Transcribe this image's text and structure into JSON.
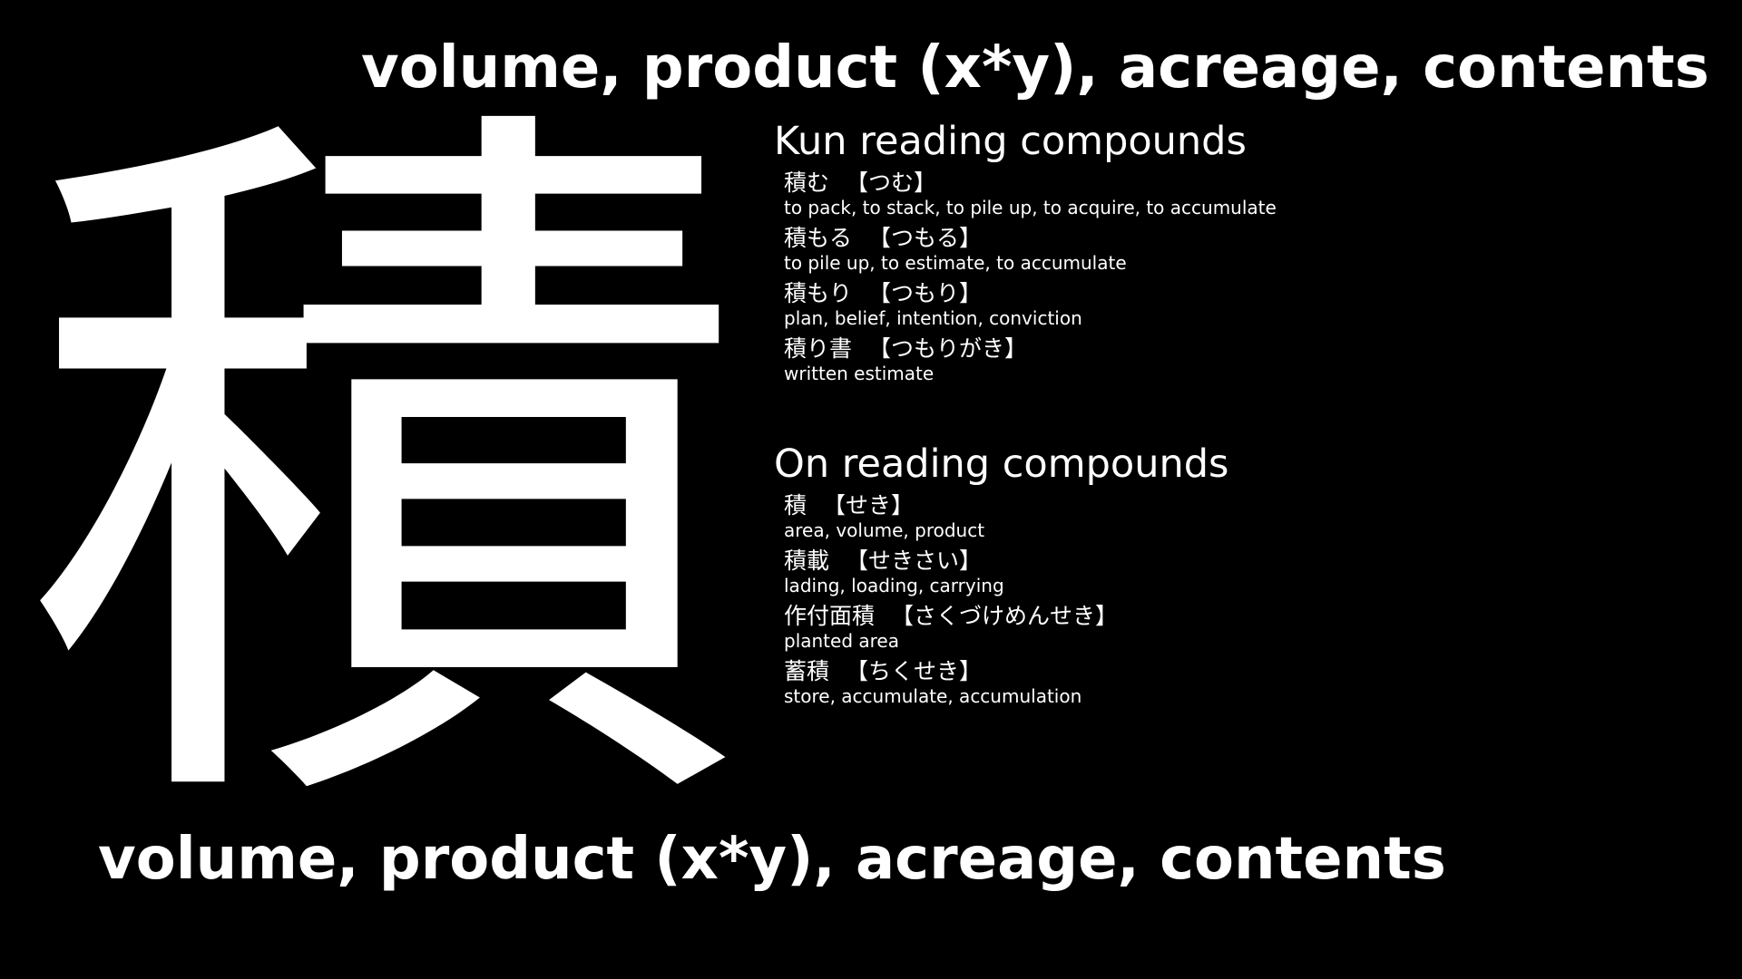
{
  "meaning": "volume, product (x*y), acreage, contents",
  "kanji": "積",
  "kun": {
    "title": "Kun reading compounds",
    "items": [
      {
        "word": "積む",
        "reading": "【つむ】",
        "meaning": "to pack, to stack, to pile up, to acquire, to accumulate"
      },
      {
        "word": "積もる",
        "reading": "【つもる】",
        "meaning": "to pile up, to estimate, to accumulate"
      },
      {
        "word": "積もり",
        "reading": "【つもり】",
        "meaning": "plan, belief, intention, conviction"
      },
      {
        "word": "積り書",
        "reading": "【つもりがき】",
        "meaning": "written estimate"
      }
    ]
  },
  "on": {
    "title": "On reading compounds",
    "items": [
      {
        "word": "積",
        "reading": "【せき】",
        "meaning": "area, volume, product"
      },
      {
        "word": "積載",
        "reading": "【せきさい】",
        "meaning": "lading, loading, carrying"
      },
      {
        "word": "作付面積",
        "reading": "【さくづけめんせき】",
        "meaning": "planted area"
      },
      {
        "word": "蓄積",
        "reading": "【ちくせき】",
        "meaning": "store, accumulate, accumulation"
      }
    ]
  }
}
